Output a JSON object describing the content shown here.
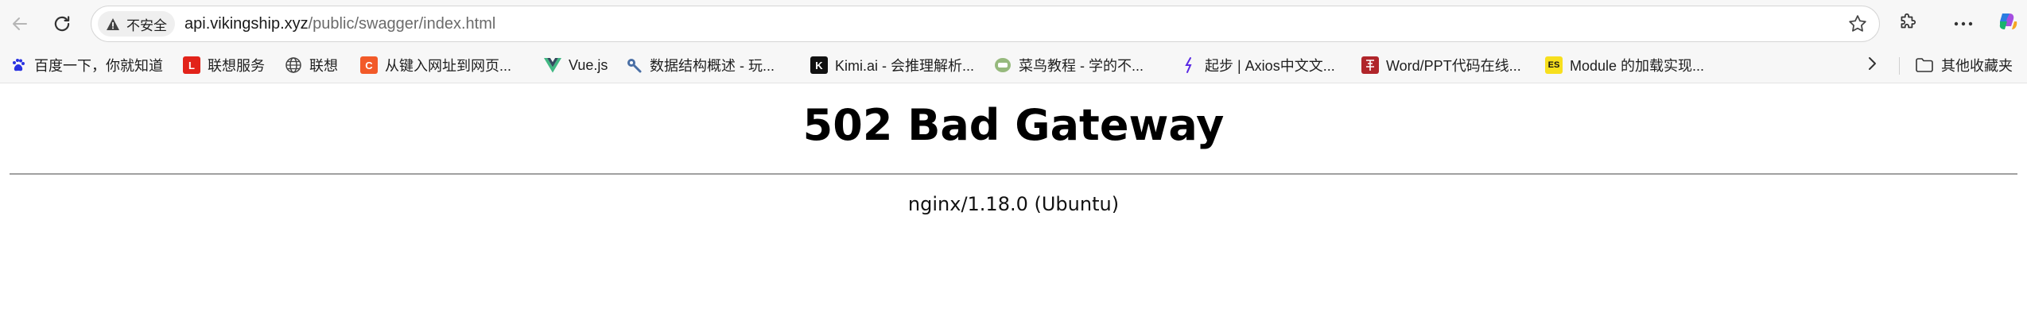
{
  "browser": {
    "security_label": "不安全",
    "url_host": "api.vikingship.xyz",
    "url_path": "/public/swagger/index.html",
    "bookmarks": [
      {
        "label": "百度一下，你就知道",
        "icon": "baidu-paw-icon",
        "color": "#2932e1"
      },
      {
        "label": "联想服务",
        "icon": "lenovo-l-icon",
        "color": "#e2231a",
        "glyph": "L"
      },
      {
        "label": "联想",
        "icon": "globe-icon",
        "color": "#555555"
      },
      {
        "label": "从键入网址到网页...",
        "icon": "c-logo-icon",
        "color": "#f25a29",
        "glyph": "C"
      },
      {
        "label": "Vue.js",
        "icon": "vue-logo-icon",
        "color": "#41b883"
      },
      {
        "label": "数据结构概述 - 玩...",
        "icon": "tool-icon",
        "color": "#4a6fa5"
      },
      {
        "label": "Kimi.ai - 会推理解析...",
        "icon": "kimi-k-icon",
        "color": "#111111",
        "glyph": "K"
      },
      {
        "label": "菜鸟教程 - 学的不...",
        "icon": "runoob-icon",
        "color": "#96b97d"
      },
      {
        "label": "起步 | Axios中文文...",
        "icon": "axios-icon",
        "color": "#5a29e4"
      },
      {
        "label": "Word/PPT代码在线...",
        "icon": "seal-icon",
        "color": "#b0252a"
      },
      {
        "label": "Module 的加载实现...",
        "icon": "es-icon",
        "color": "#f7df1e",
        "glyph": "ES"
      }
    ],
    "other_bookmarks_label": "其他收藏夹"
  },
  "page": {
    "title": "502 Bad Gateway",
    "server": "nginx/1.18.0 (Ubuntu)"
  }
}
